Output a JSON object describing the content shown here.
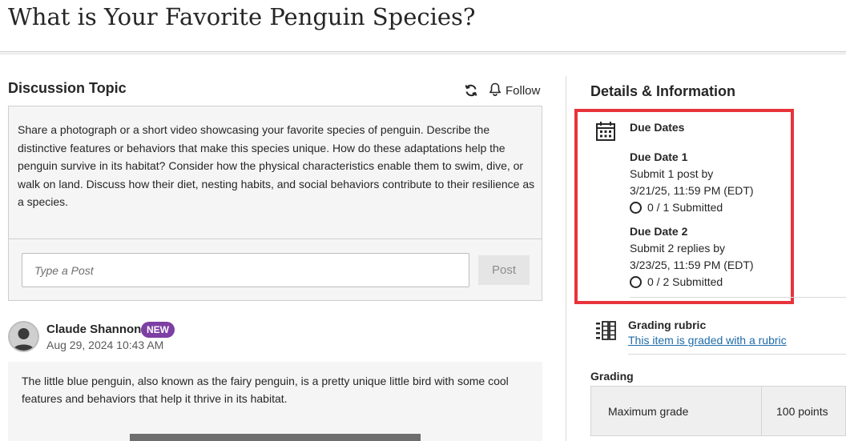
{
  "page": {
    "title": "What is Your Favorite Penguin Species?"
  },
  "discussion": {
    "heading": "Discussion Topic",
    "refresh_icon": "refresh-icon",
    "follow_icon": "bell-icon",
    "follow_label": "Follow",
    "prompt": "Share a photograph or a short video showcasing your favorite species of penguin. Describe the distinctive features or behaviors that make this species unique. How do these adaptations help the penguin survive in its habitat? Consider how the physical characteristics enable them to swim, dive, or walk on land. Discuss how their diet, nesting habits, and social behaviors contribute to their resilience as a species.",
    "post_placeholder": "Type a Post",
    "post_button": "Post"
  },
  "post": {
    "author": "Claude Shannon",
    "badge": "NEW",
    "badge_color": "#7d3fa3",
    "date": "Aug 29, 2024 10:43 AM",
    "text": "The little blue penguin, also known as the fairy penguin, is a pretty unique little bird with some cool features and behaviors that help it thrive in its habitat."
  },
  "details": {
    "heading": "Details & Information",
    "highlight_color": "#e8333a",
    "due_dates": {
      "title": "Due Dates",
      "icon": "calendar-icon",
      "items": [
        {
          "name": "Due Date 1",
          "requirement": "Submit 1 post by",
          "deadline": "3/21/25, 11:59 PM (EDT)",
          "status": "0 / 1 Submitted"
        },
        {
          "name": "Due Date 2",
          "requirement": "Submit 2 replies by",
          "deadline": "3/23/25, 11:59 PM (EDT)",
          "status": "0 / 2 Submitted"
        }
      ]
    },
    "rubric": {
      "icon": "rubric-icon",
      "title": "Grading rubric",
      "link": "This item is graded with a rubric"
    },
    "grading": {
      "heading": "Grading",
      "label": "Maximum grade",
      "value": "100 points"
    }
  }
}
